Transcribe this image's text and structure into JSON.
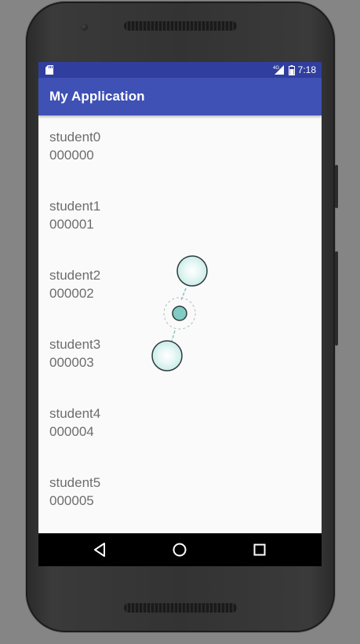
{
  "device": {
    "model": "android-phone",
    "body_color": "#333333"
  },
  "status_bar": {
    "time": "7:18",
    "network": "4G",
    "background": "#303f9f",
    "icons": [
      "sd-card-icon",
      "signal-icon",
      "battery-icon"
    ]
  },
  "app_bar": {
    "title": "My Application",
    "background": "#3f51b5"
  },
  "list": {
    "items": [
      {
        "name": "student0",
        "id": "000000"
      },
      {
        "name": "student1",
        "id": "000001"
      },
      {
        "name": "student2",
        "id": "000002"
      },
      {
        "name": "student3",
        "id": "000003"
      },
      {
        "name": "student4",
        "id": "000004"
      },
      {
        "name": "student5",
        "id": "000005"
      }
    ],
    "text_color": "#6d6d6d"
  },
  "nav_bar": {
    "buttons": [
      "back-icon",
      "home-icon",
      "recents-icon"
    ]
  },
  "gesture_overlay": {
    "type": "pinch-touch-indicator",
    "color": "#80cbc4"
  }
}
